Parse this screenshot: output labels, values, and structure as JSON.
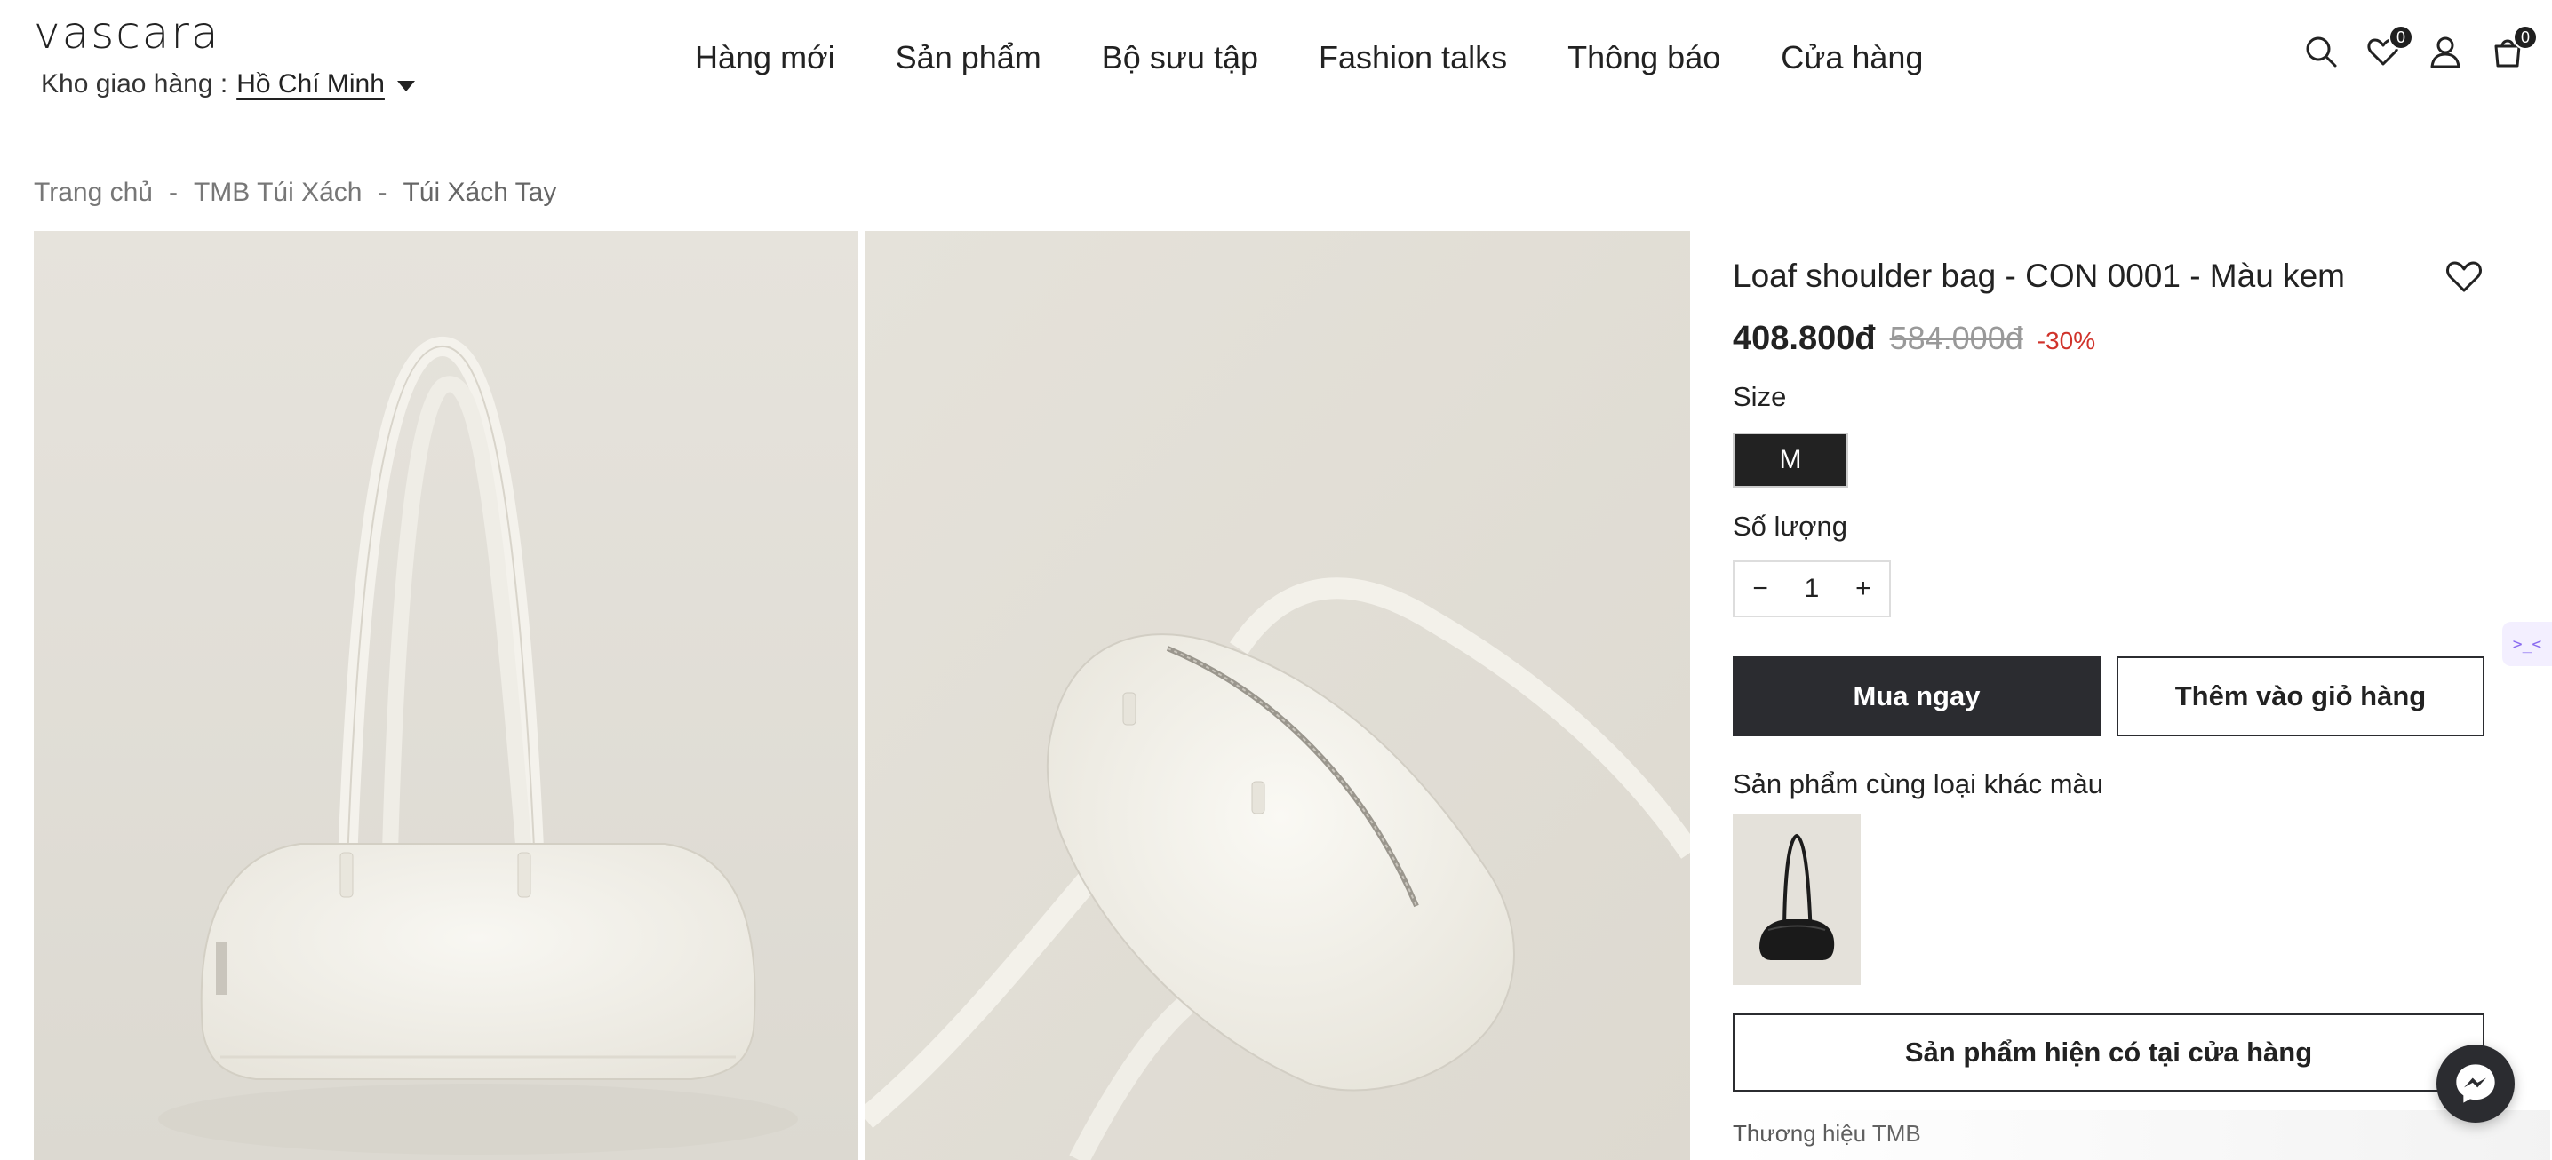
{
  "header": {
    "logo": "vascara",
    "delivery_label": "Kho giao hàng :",
    "delivery_city": "Hồ Chí Minh",
    "nav": [
      "Hàng mới",
      "Sản phẩm",
      "Bộ sưu tập",
      "Fashion talks",
      "Thông báo",
      "Cửa hàng"
    ],
    "icons": [
      "search-icon",
      "heart-icon",
      "user-icon",
      "cart-icon"
    ],
    "wishlist_count": "0",
    "cart_count": "0"
  },
  "breadcrumb": [
    "Trang chủ",
    "TMB Túi Xách",
    "Túi Xách Tay"
  ],
  "breadcrumb_separator": "-",
  "product": {
    "title": "Loaf shoulder bag - CON 0001 - Màu kem",
    "price": "408.800đ",
    "old_price": "584.000đ",
    "discount": "-30%",
    "size_label": "Size",
    "size_selected": "M",
    "quantity_label": "Số lượng",
    "quantity": "1",
    "qty_minus": "−",
    "qty_plus": "+",
    "buy_now": "Mua ngay",
    "add_to_cart": "Thêm vào giỏ hàng",
    "variants_label": "Sản phẩm cùng loại khác màu",
    "store_button": "Sản phẩm hiện có tại cửa hàng",
    "brand": "Thương hiệu TMB"
  },
  "colors": {
    "primary_dark": "#2b2c30",
    "discount_red": "#d0322a",
    "photo_bg": "#e4e1da",
    "bag_cream": "#f3f1ea"
  },
  "side_widget": ">_<"
}
